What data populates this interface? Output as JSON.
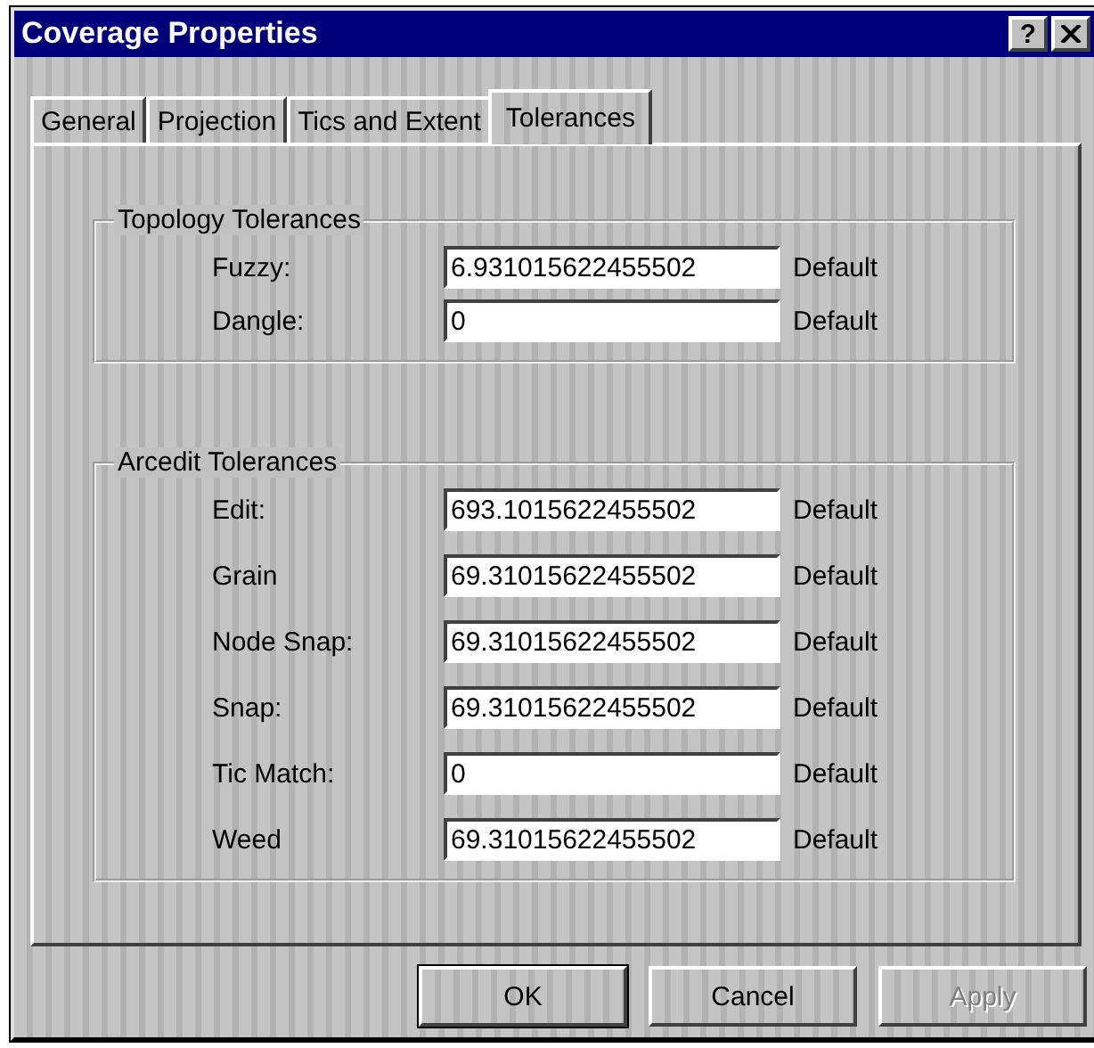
{
  "window": {
    "title": "Coverage Properties",
    "help": "?"
  },
  "tabs": [
    {
      "label": "General",
      "selected": false
    },
    {
      "label": "Projection",
      "selected": false
    },
    {
      "label": "Tics and Extent",
      "selected": false
    },
    {
      "label": "Tolerances",
      "selected": true
    }
  ],
  "groups": [
    {
      "title": "Topology Tolerances",
      "rows": [
        {
          "label": "Fuzzy:",
          "value": "6.931015622455502",
          "note": "Default"
        },
        {
          "label": "Dangle:",
          "value": "0",
          "note": "Default"
        }
      ]
    },
    {
      "title": "Arcedit Tolerances",
      "rows": [
        {
          "label": "Edit:",
          "value": "693.1015622455502",
          "note": "Default"
        },
        {
          "label": "Grain",
          "value": "69.31015622455502",
          "note": "Default"
        },
        {
          "label": "Node Snap:",
          "value": "69.31015622455502",
          "note": "Default"
        },
        {
          "label": "Snap:",
          "value": "69.31015622455502",
          "note": "Default"
        },
        {
          "label": "Tic Match:",
          "value": "0",
          "note": "Default"
        },
        {
          "label": "Weed",
          "value": "69.31015622455502",
          "note": "Default"
        }
      ]
    }
  ],
  "buttons": [
    {
      "label": "OK",
      "disabled": false,
      "default": true
    },
    {
      "label": "Cancel",
      "disabled": false,
      "default": false
    },
    {
      "label": "Apply",
      "disabled": true,
      "default": false
    }
  ]
}
